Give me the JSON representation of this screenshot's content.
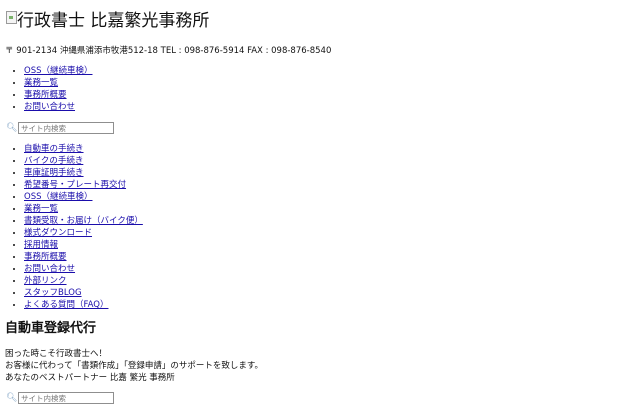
{
  "header": {
    "logo_text": "行政書士 比嘉繁光事務所",
    "address": "〒 901-2134 沖縄県浦添市牧港512-18 TEL : 098-876-5914 FAX : 098-876-8540"
  },
  "nav_main": {
    "items": [
      {
        "label": "OSS（継続車検）"
      },
      {
        "label": "業務一覧"
      },
      {
        "label": "事務所概要"
      },
      {
        "label": "お問い合わせ"
      }
    ]
  },
  "search": {
    "icon": "search-icon",
    "placeholder": "サイト内検索"
  },
  "nav_sub": {
    "items": [
      {
        "label": "自動車の手続き"
      },
      {
        "label": "バイクの手続き"
      },
      {
        "label": "車庫証明手続き"
      },
      {
        "label": "希望番号・プレート再交付"
      },
      {
        "label": "OSS（継続車検）"
      },
      {
        "label": "業務一覧"
      },
      {
        "label": "書類受取・お届け（バイク便）"
      },
      {
        "label": "様式ダウンロード"
      },
      {
        "label": "採用情報"
      },
      {
        "label": "事務所概要"
      },
      {
        "label": "お問い合わせ"
      },
      {
        "label": "外部リンク"
      },
      {
        "label": "スタッフBLOG"
      },
      {
        "label": "よくある質問（FAQ）"
      }
    ]
  },
  "main": {
    "title": "自動車登録代行",
    "lines": [
      "困った時こそ行政書士へ！",
      "お客様に代わって「書類作成」「登録申請」のサポートを致します。",
      "あなたのベストパートナー 比嘉 繁光 事務所"
    ]
  },
  "colors": {
    "link": "#1a0dab",
    "text": "#111111",
    "search_icon": "#7a9fc2"
  }
}
